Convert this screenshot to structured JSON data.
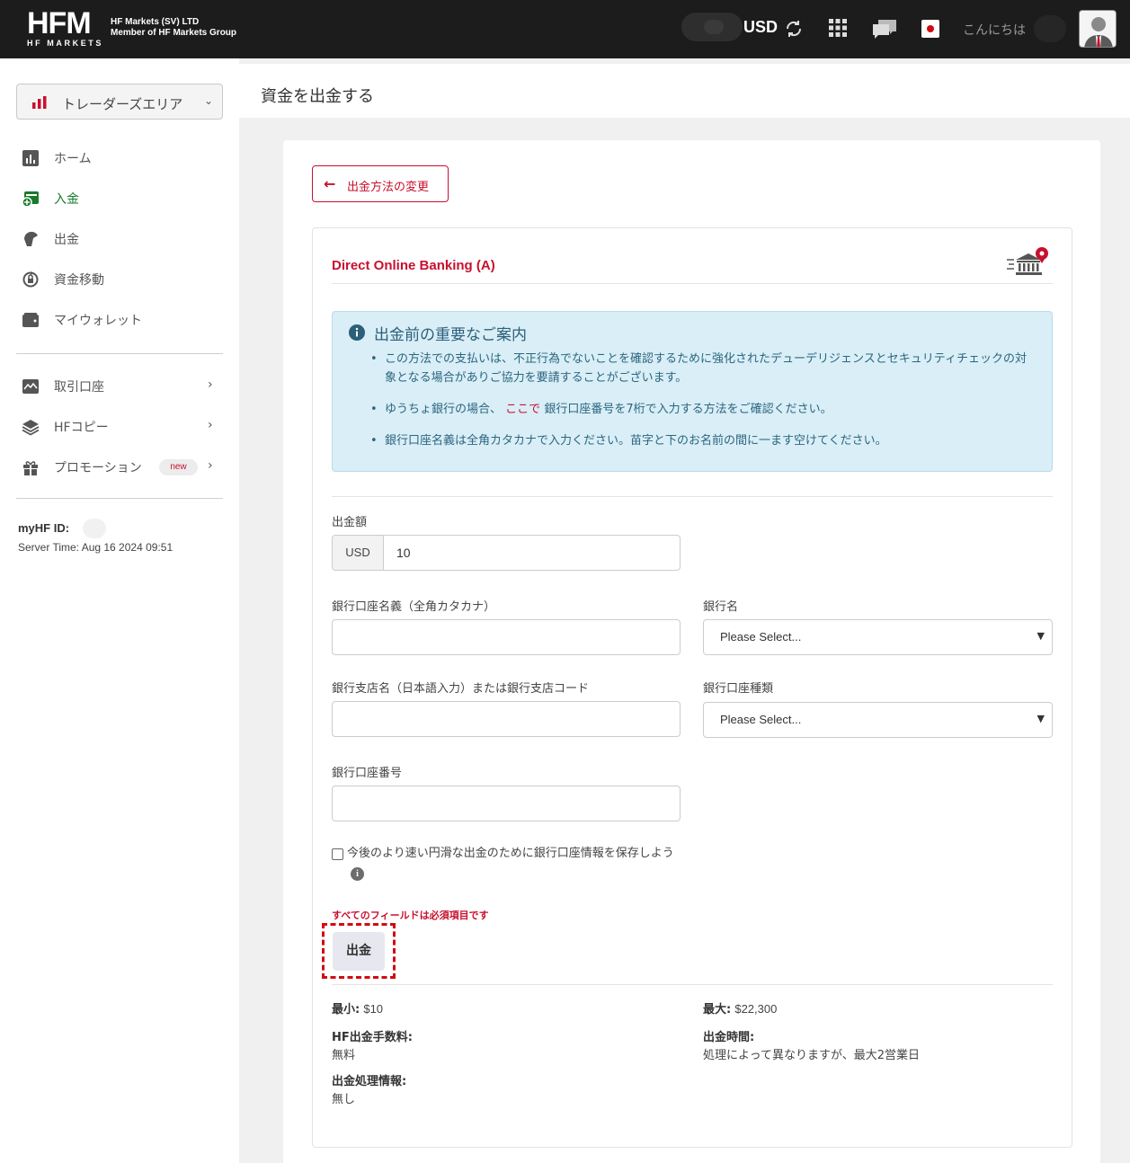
{
  "header": {
    "logo_main": "HFM",
    "logo_sub": "HF MARKETS",
    "company_line1": "HF Markets (SV) LTD",
    "company_line2": "Member of HF Markets Group",
    "currency": "USD",
    "greeting": "こんにちは",
    "icons": [
      "refresh-icon",
      "apps-grid-icon",
      "chat-icon",
      "japan-flag-icon",
      "user-avatar"
    ]
  },
  "sidebar": {
    "area_label": "トレーダーズエリア",
    "items": [
      {
        "label": "ホーム",
        "icon": "dashboard-icon"
      },
      {
        "label": "入金",
        "icon": "deposit-icon"
      },
      {
        "label": "出金",
        "icon": "withdraw-icon"
      },
      {
        "label": "資金移動",
        "icon": "transfer-icon"
      },
      {
        "label": "マイウォレット",
        "icon": "wallet-icon"
      },
      {
        "label": "取引口座",
        "icon": "trading-account-icon"
      },
      {
        "label": "HFコピー",
        "icon": "layers-icon"
      },
      {
        "label": "プロモーション",
        "icon": "gift-icon",
        "badge": "new"
      }
    ],
    "myhf_label": "myHF ID:",
    "server_time": "Server Time: Aug 16 2024 09:51"
  },
  "page": {
    "title": "資金を出金する",
    "back_button": "出金方法の変更",
    "method_title": "Direct Online Banking (A)"
  },
  "notice": {
    "title": "出金前の重要なご案内",
    "item1": "この方法での支払いは、不正行為でないことを確認するために強化されたデューデリジェンスとセキュリティチェックの対象となる場合がありご協力を要請することがございます。",
    "item2_pre": "ゆうちょ銀行の場合、",
    "item2_link": "ここで",
    "item2_post": "銀行口座番号を7桁で入力する方法をご確認ください。",
    "item3": "銀行口座名義は全角カタカナで入力ください。苗字と下のお名前の間に一ます空けてください。"
  },
  "form": {
    "amount_label": "出金額",
    "amount_currency": "USD",
    "amount_value": "10",
    "account_name_label": "銀行口座名義（全角カタカナ）",
    "bank_name_label": "銀行名",
    "bank_name_selected": "Please Select...",
    "branch_label": "銀行支店名（日本語入力）または銀行支店コード",
    "account_type_label": "銀行口座種類",
    "account_type_selected": "Please Select...",
    "account_number_label": "銀行口座番号",
    "save_checkbox_label": "今後のより速い円滑な出金のために銀行口座情報を保存しよう",
    "required_note": "すべてのフィールドは必須項目です",
    "submit_label": "出金"
  },
  "limits": {
    "min_label": "最小:",
    "min_value": "$10",
    "max_label": "最大:",
    "max_value": "$22,300",
    "fee_label": "HF出金手数料:",
    "fee_value": "無料",
    "time_label": "出金時間:",
    "time_value": "処理によって異なりますが、最大2営業日",
    "info_label": "出金処理情報:",
    "info_value": "無し"
  },
  "colors": {
    "brand_red": "#c8102e",
    "topbar": "#1c1c1c",
    "notice_bg": "#d9eef6",
    "active_green": "#1a7a2b"
  }
}
